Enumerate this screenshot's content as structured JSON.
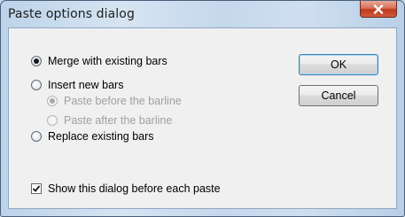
{
  "window": {
    "title": "Paste options dialog"
  },
  "options": {
    "merge_label": "Merge with existing bars",
    "insert_label": "Insert new bars",
    "paste_before_label": "Paste before the barline",
    "paste_after_label": "Paste after the barline",
    "replace_label": "Replace existing bars",
    "selected": "merge",
    "insert_sub_selected": "paste_before"
  },
  "checkbox": {
    "show_dialog_label": "Show this dialog before each paste",
    "checked": true
  },
  "buttons": {
    "ok_label": "OK",
    "cancel_label": "Cancel"
  },
  "icons": {
    "close": "close-icon",
    "checkmark": "checkmark-icon"
  },
  "colors": {
    "close_button": "#c8452a",
    "dialog_face": "#f0f0f0",
    "frame": "#c9dcee",
    "disabled_text": "#a0a0a0"
  }
}
